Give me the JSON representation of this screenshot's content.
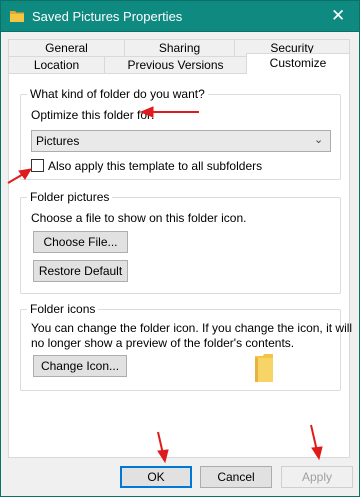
{
  "window": {
    "title": "Saved Pictures Properties"
  },
  "tabs_row1": [
    "General",
    "Sharing",
    "Security"
  ],
  "tabs_row2": [
    "Location",
    "Previous Versions",
    "Customize"
  ],
  "group1": {
    "legend": "What kind of folder do you want?",
    "optimize_label": "Optimize this folder for:",
    "selected": "Pictures",
    "checkbox_label": "Also apply this template to all subfolders",
    "checkbox_checked": false
  },
  "group2": {
    "legend": "Folder pictures",
    "desc": "Choose a file to show on this folder icon.",
    "choose_button": "Choose File...",
    "restore_button": "Restore Default"
  },
  "group3": {
    "legend": "Folder icons",
    "desc_line1": "You can change the folder icon. If you change the icon, it will",
    "desc_line2": "no longer show a preview of the folder's contents.",
    "change_button": "Change Icon..."
  },
  "footer": {
    "ok": "OK",
    "cancel": "Cancel",
    "apply": "Apply"
  },
  "icons": [
    "folder-icon",
    "close-icon",
    "chevron-down-icon",
    "red-arrow-annotation"
  ],
  "colors": {
    "titlebar": "#0f8a80",
    "annotation": "#e01b1b",
    "folder": "#f5c542"
  }
}
